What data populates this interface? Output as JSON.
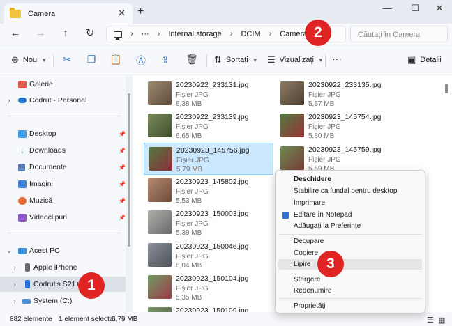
{
  "window": {
    "tab_title": "Camera",
    "tab_close": "✕",
    "new_tab": "+",
    "minimize": "—",
    "maximize": "☐",
    "close": "✕"
  },
  "nav_buttons": {
    "back": "←",
    "forward": "→",
    "up": "↑",
    "refresh": "↻"
  },
  "address": {
    "more": "···",
    "crumbs": [
      "Internal storage",
      "DCIM",
      "Camera"
    ],
    "separator": "›"
  },
  "search": {
    "placeholder": "Căutați în Camera"
  },
  "toolbar": {
    "new_label": "Nou",
    "sort_label": "Sortați",
    "view_label": "Vizualizați",
    "more": "···",
    "details_label": "Detalii"
  },
  "sidebar": {
    "items": [
      {
        "label": "Galerie",
        "icon": "gallery-icon",
        "color": "#e05a4e"
      },
      {
        "label": "Codrut - Personal",
        "icon": "onedrive-icon",
        "color": "#1f72c9"
      },
      {
        "label": "Desktop",
        "icon": "desktop-icon",
        "color": "#3f9be6"
      },
      {
        "label": "Downloads",
        "icon": "download-icon",
        "color": "#2aa39b"
      },
      {
        "label": "Documente",
        "icon": "documents-icon",
        "color": "#5a7fb8"
      },
      {
        "label": "Imagini",
        "icon": "pictures-icon",
        "color": "#3d82d6"
      },
      {
        "label": "Muzică",
        "icon": "music-icon",
        "color": "#e46a3a"
      },
      {
        "label": "Videoclipuri",
        "icon": "videos-icon",
        "color": "#8e56c9"
      },
      {
        "label": "Acest PC",
        "icon": "this-pc-icon",
        "color": "#3a8fd9"
      },
      {
        "label": "Apple iPhone",
        "icon": "phone-icon",
        "color": "#6f6f6f"
      },
      {
        "label": "Codrut's S21+",
        "icon": "phone-icon",
        "color": "#2b6fd2"
      },
      {
        "label": "System (C:)",
        "icon": "drive-icon",
        "color": "#4b8fd6"
      }
    ]
  },
  "files": [
    {
      "name": "20230922_233131.jpg",
      "type": "Fișier JPG",
      "size": "6,38 MB",
      "thumb": "#7a6a55"
    },
    {
      "name": "20230922_233135.jpg",
      "type": "Fișier JPG",
      "size": "5,57 MB",
      "thumb": "#6d5f4d"
    },
    {
      "name": "20230922_233139.jpg",
      "type": "Fișier JPG",
      "size": "6,65 MB",
      "thumb": "#5d6d47"
    },
    {
      "name": "20230923_145754.jpg",
      "type": "Fișier JPG",
      "size": "5,80 MB",
      "thumb": "#7b3d3d"
    },
    {
      "name": "20230923_145756.jpg",
      "type": "Fișier JPG",
      "size": "5,79 MB",
      "thumb": "#6e3d46"
    },
    {
      "name": "20230923_145759.jpg",
      "type": "Fișier JPG",
      "size": "5,59 MB",
      "thumb": "#5f4f3c"
    },
    {
      "name": "20230923_145802.jpg",
      "type": "Fișier JPG",
      "size": "5,53 MB",
      "thumb": "#8a5d4c"
    },
    {
      "name": "20230923_150003.jpg",
      "type": "Fișier JPG",
      "size": "5,39 MB",
      "thumb": "#8c8a88"
    },
    {
      "name": "20230923_150046.jpg",
      "type": "Fișier JPG",
      "size": "6,04 MB",
      "thumb": "#6b6f73"
    },
    {
      "name": "20230923_150104.jpg",
      "type": "Fișier JPG",
      "size": "5,35 MB",
      "thumb": "#5b7257"
    },
    {
      "name": "20230923_150109.jpg",
      "type": "",
      "size": "",
      "thumb": "#6a7a5e"
    }
  ],
  "status": {
    "count": "882 elemente",
    "selection": "1 element selectat",
    "selection_size": "5,79 MB"
  },
  "context_menu": {
    "open": "Deschidere",
    "set_background": "Stabilire ca fundal pentru desktop",
    "print": "Imprimare",
    "edit_notepad": "Editare în Notepad",
    "add_favorites": "Adăugați la Preferințe",
    "cut": "Decupare",
    "copy": "Copiere",
    "paste": "Lipire",
    "delete": "Ștergere",
    "rename": "Redenumire",
    "properties": "Proprietăți"
  },
  "callouts": [
    "1",
    "2",
    "3"
  ],
  "colors": {
    "accent": "#0067c0",
    "selection": "#cce8ff",
    "callout": "#e02424"
  }
}
